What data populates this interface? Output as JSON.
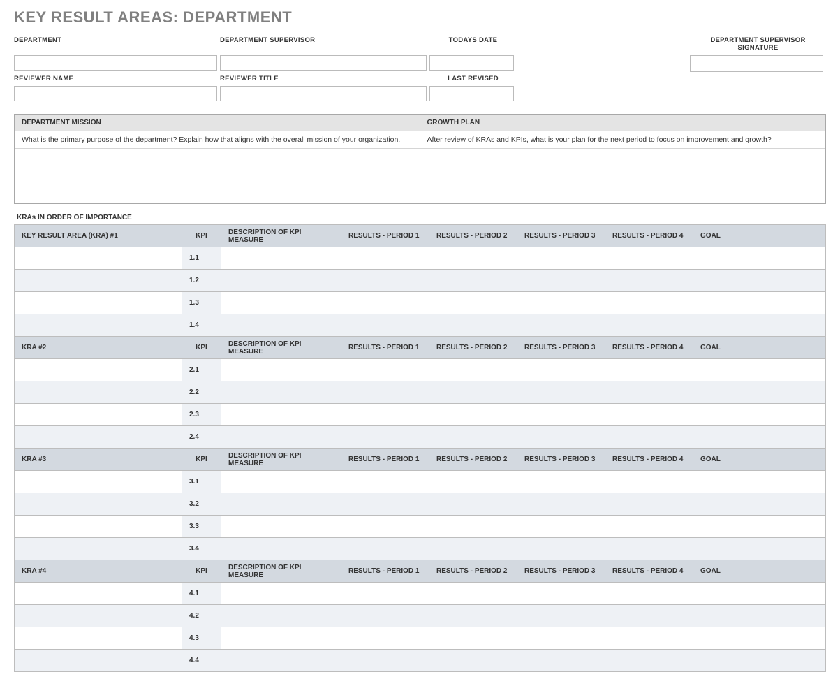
{
  "title": "KEY RESULT AREAS: DEPARTMENT",
  "top": {
    "department_label": "DEPARTMENT",
    "supervisor_label": "DEPARTMENT SUPERVISOR",
    "todays_date_label": "TODAYS DATE",
    "signature_label": "DEPARTMENT SUPERVISOR SIGNATURE",
    "reviewer_name_label": "REVIEWER NAME",
    "reviewer_title_label": "REVIEWER TITLE",
    "last_revised_label": "LAST REVISED"
  },
  "mission": {
    "header": "DEPARTMENT MISSION",
    "prompt": "What is the primary purpose of the department?  Explain how that aligns with the overall mission of your organization.",
    "body": ""
  },
  "growth": {
    "header": "GROWTH PLAN",
    "prompt": "After review of KRAs and KPIs, what is your plan for the next period to focus on improvement and growth?",
    "body": ""
  },
  "section_label": "KRAs IN ORDER OF IMPORTANCE",
  "columns": {
    "kpi": "KPI",
    "desc": "DESCRIPTION OF KPI MEASURE",
    "r1": "RESULTS - PERIOD 1",
    "r2": "RESULTS - PERIOD 2",
    "r3": "RESULTS - PERIOD 3",
    "r4": "RESULTS - PERIOD 4",
    "goal": "GOAL"
  },
  "kras": [
    {
      "name_header": "KEY RESULT AREA (KRA) #1",
      "kpis": [
        {
          "num": "1.1",
          "desc": "",
          "r1": "",
          "r2": "",
          "r3": "",
          "r4": "",
          "goal": ""
        },
        {
          "num": "1.2",
          "desc": "",
          "r1": "",
          "r2": "",
          "r3": "",
          "r4": "",
          "goal": ""
        },
        {
          "num": "1.3",
          "desc": "",
          "r1": "",
          "r2": "",
          "r3": "",
          "r4": "",
          "goal": ""
        },
        {
          "num": "1.4",
          "desc": "",
          "r1": "",
          "r2": "",
          "r3": "",
          "r4": "",
          "goal": ""
        }
      ]
    },
    {
      "name_header": "KRA #2",
      "kpis": [
        {
          "num": "2.1",
          "desc": "",
          "r1": "",
          "r2": "",
          "r3": "",
          "r4": "",
          "goal": ""
        },
        {
          "num": "2.2",
          "desc": "",
          "r1": "",
          "r2": "",
          "r3": "",
          "r4": "",
          "goal": ""
        },
        {
          "num": "2.3",
          "desc": "",
          "r1": "",
          "r2": "",
          "r3": "",
          "r4": "",
          "goal": ""
        },
        {
          "num": "2.4",
          "desc": "",
          "r1": "",
          "r2": "",
          "r3": "",
          "r4": "",
          "goal": ""
        }
      ]
    },
    {
      "name_header": "KRA #3",
      "kpis": [
        {
          "num": "3.1",
          "desc": "",
          "r1": "",
          "r2": "",
          "r3": "",
          "r4": "",
          "goal": ""
        },
        {
          "num": "3.2",
          "desc": "",
          "r1": "",
          "r2": "",
          "r3": "",
          "r4": "",
          "goal": ""
        },
        {
          "num": "3.3",
          "desc": "",
          "r1": "",
          "r2": "",
          "r3": "",
          "r4": "",
          "goal": ""
        },
        {
          "num": "3.4",
          "desc": "",
          "r1": "",
          "r2": "",
          "r3": "",
          "r4": "",
          "goal": ""
        }
      ]
    },
    {
      "name_header": "KRA #4",
      "kpis": [
        {
          "num": "4.1",
          "desc": "",
          "r1": "",
          "r2": "",
          "r3": "",
          "r4": "",
          "goal": ""
        },
        {
          "num": "4.2",
          "desc": "",
          "r1": "",
          "r2": "",
          "r3": "",
          "r4": "",
          "goal": ""
        },
        {
          "num": "4.3",
          "desc": "",
          "r1": "",
          "r2": "",
          "r3": "",
          "r4": "",
          "goal": ""
        },
        {
          "num": "4.4",
          "desc": "",
          "r1": "",
          "r2": "",
          "r3": "",
          "r4": "",
          "goal": ""
        }
      ]
    }
  ]
}
